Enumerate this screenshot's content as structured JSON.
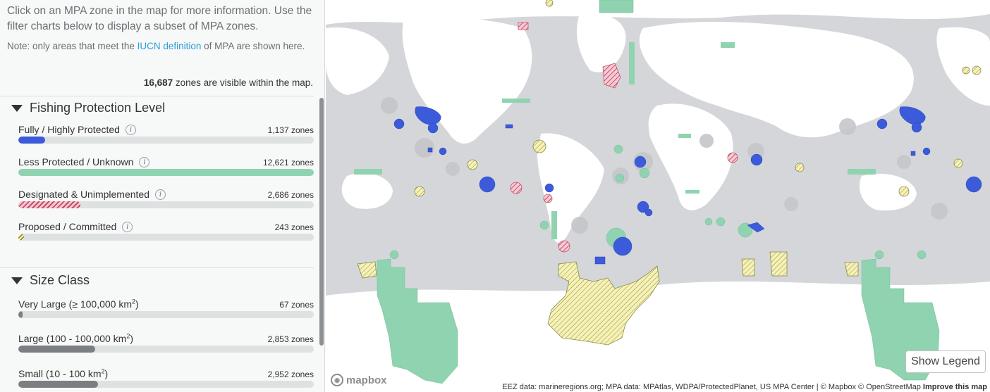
{
  "intro": {
    "text": "Click on an MPA zone in the map for more information. Use the filter charts below to display a subset of MPA zones.",
    "note_prefix": "Note: only areas that meet the ",
    "note_link": "IUCN definition",
    "note_suffix": " of MPA are shown here."
  },
  "visible": {
    "count": "16,687",
    "suffix": " zones are visible within the map."
  },
  "fishing": {
    "title": "Fishing Protection Level",
    "rows": [
      {
        "label": "Fully / Highly Protected",
        "count": "1,137 zones",
        "fraction": 0.09,
        "style": "blue"
      },
      {
        "label": "Less Protected / Unknown",
        "count": "12,621 zones",
        "fraction": 1.0,
        "style": "green"
      },
      {
        "label": "Designated & Unimplemented",
        "count": "2,686 zones",
        "fraction": 0.21,
        "style": "hatch-red"
      },
      {
        "label": "Proposed / Committed",
        "count": "243 zones",
        "fraction": 0.02,
        "style": "hatch-yellow"
      }
    ],
    "info_glyph": "i"
  },
  "size": {
    "title": "Size Class",
    "rows": [
      {
        "label": "Very Large (≥ 100,000 km",
        "sup": "2",
        "close": ")",
        "count": "67 zones",
        "fraction": 0.01
      },
      {
        "label": "Large (100 - 100,000 km",
        "sup": "2",
        "close": ")",
        "count": "2,853 zones",
        "fraction": 0.26
      },
      {
        "label": "Small (10 - 100 km",
        "sup": "2",
        "close": ")",
        "count": "2,952 zones",
        "fraction": 0.27
      }
    ]
  },
  "map": {
    "show_legend": "Show Legend",
    "logo": "mapbox",
    "attribution": "EEZ data: marineregions.org; MPA data: MPAtlas, WDPA/ProtectedPlanet, US MPA Center | © Mapbox © OpenStreetMap",
    "improve": "Improve this map",
    "colors": {
      "ocean": "#d5d6d9",
      "eez": "#c5c6ca",
      "land": "#ffffff",
      "fully": "#3b5bdb",
      "less": "#8fd3b0",
      "designated": "#c94d69",
      "proposed": "#efe9a0"
    }
  }
}
